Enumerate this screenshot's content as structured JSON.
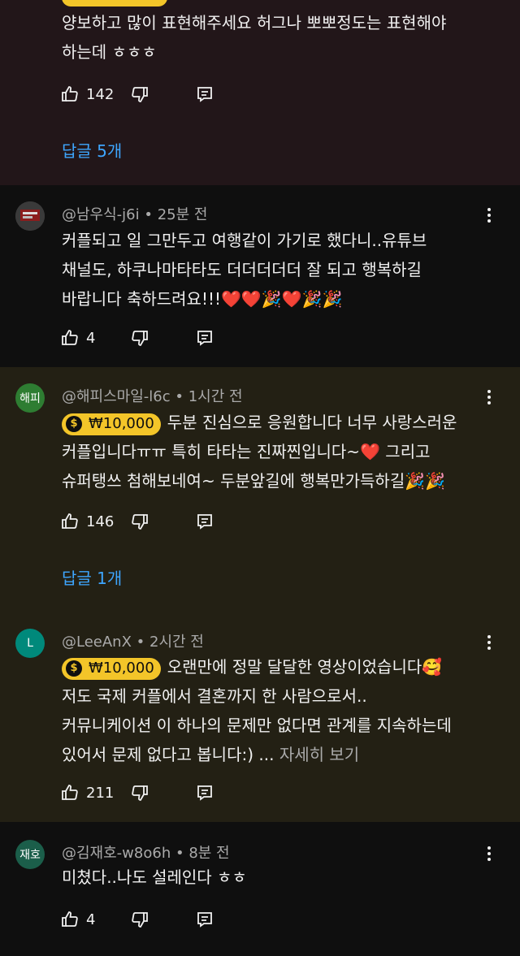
{
  "comments": [
    {
      "text_lines": [
        "양보하고 많이 표현해주세요 허그나 뽀뽀정도는 표현해야",
        "하는데 ㅎㅎㅎ"
      ],
      "likes": "142",
      "replies_label": "답글 5개"
    },
    {
      "author": "@남우식-j6i",
      "time": "25분 전",
      "text_lines": [
        "커플되고 일 그만두고 여행같이 가기로 했다니..유튜브",
        "채널도, 하쿠나마타타도 더더더더더 잘 되고 행복하길",
        "바랍니다 축하드려요!!!❤️❤️🎉❤️🎉🎉"
      ],
      "likes": "4"
    },
    {
      "author": "@해피스마일-l6c",
      "time": "1시간 전",
      "avatar_text": "해피",
      "avatar_color": "#2e7d32",
      "badge": "₩10,000",
      "text_lines": [
        "두분 진심으로 응원합니다 너무 사랑스러운",
        "커플입니다ㅠㅠ 특히 타타는 진짜찐입니다~❤️ 그리고",
        "슈퍼탱쓰 첨해보네여~ 두분앞길에 행복만가득하길🎉🎉"
      ],
      "likes": "146",
      "replies_label": "답글 1개"
    },
    {
      "author": "@LeeAnX",
      "time": "2시간 전",
      "avatar_text": "L",
      "avatar_color": "#00897b",
      "badge": "₩10,000",
      "text_lines": [
        "오랜만에 정말 달달한 영상이었습니다🥰",
        "저도 국제 커플에서 결혼까지 한 사람으로서..",
        "커뮤니케이션 이 하나의 문제만 없다면 관계를 지속하는데",
        "있어서 문제 없다고 봅니다:) ..."
      ],
      "more_label": "자세히 보기",
      "likes": "211"
    },
    {
      "author": "@김재호-w8o6h",
      "time": "8분 전",
      "avatar_text": "재호",
      "avatar_color": "#1b5e4a",
      "text_lines": [
        "미쳤다..나도 설레인다 ㅎㅎ"
      ],
      "likes": "4"
    }
  ],
  "icons": {
    "like": "thumbs-up-icon",
    "dislike": "thumbs-down-icon",
    "reply": "comment-reply-icon",
    "menu": "more-vertical-icon",
    "coin": "$"
  },
  "colors": {
    "accent_link": "#3ea6ff",
    "super_thanks": "#f3c529"
  }
}
